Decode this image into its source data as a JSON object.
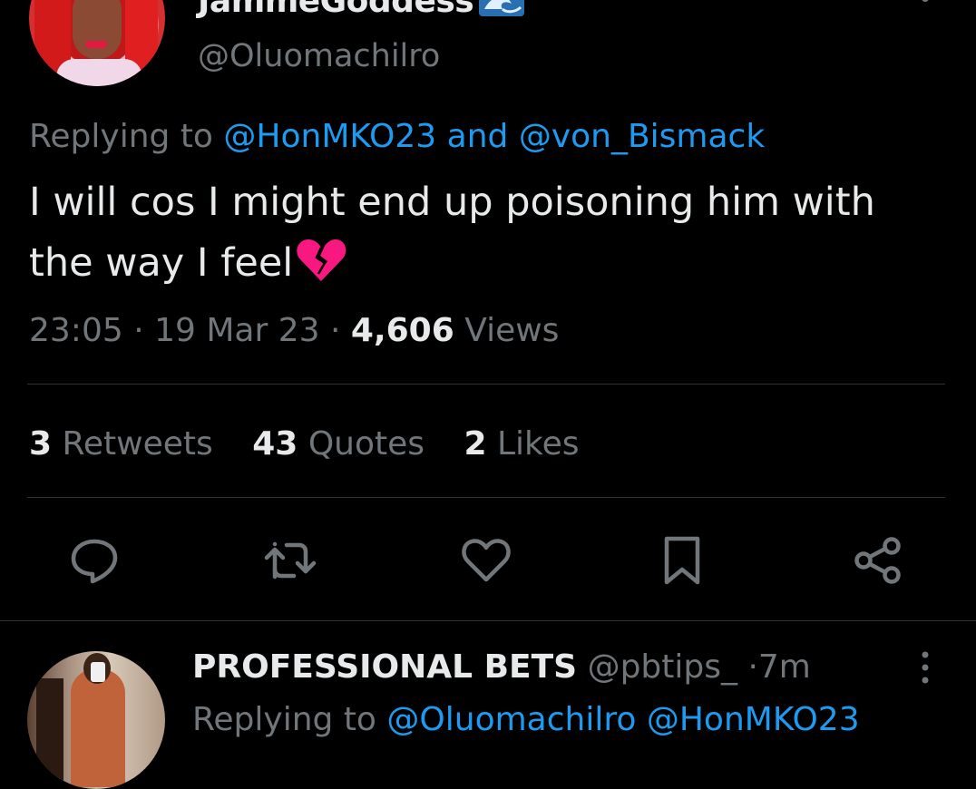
{
  "tweet": {
    "display_name": "ЈаmmeGoddess",
    "handle": "@Oluomachilro",
    "replying_prefix": "Replying to",
    "reply_mention_1": "@HonMKO23",
    "reply_and": "and",
    "reply_mention_2": "@von_Bismack",
    "text": "I will cos I might end up poisoning him with the way I feel",
    "emoji": "broken-heart",
    "time": "23:05",
    "date": "19 Mar 23",
    "views_count": "4,606",
    "views_label": "Views",
    "separator": "·",
    "stats": {
      "retweets_count": "3",
      "retweets_label": "Retweets",
      "quotes_count": "43",
      "quotes_label": "Quotes",
      "likes_count": "2",
      "likes_label": "Likes"
    },
    "actions": [
      "reply-icon",
      "retweet-icon",
      "like-icon",
      "bookmark-icon",
      "share-icon"
    ]
  },
  "reply_tweet": {
    "display_name": "PROFESSIONAL BETS",
    "handle": "@pbtips_",
    "time_ago": "7m",
    "separator": "·",
    "replying_prefix": "Replying to",
    "mention_1": "@Oluomachilro",
    "mention_2": "@HonMKO23"
  },
  "colors": {
    "background": "#000000",
    "text": "#e7e9ea",
    "secondary": "#71767b",
    "accent": "#1d9bf0",
    "divider": "#2f3336",
    "heart": "#f91880"
  }
}
